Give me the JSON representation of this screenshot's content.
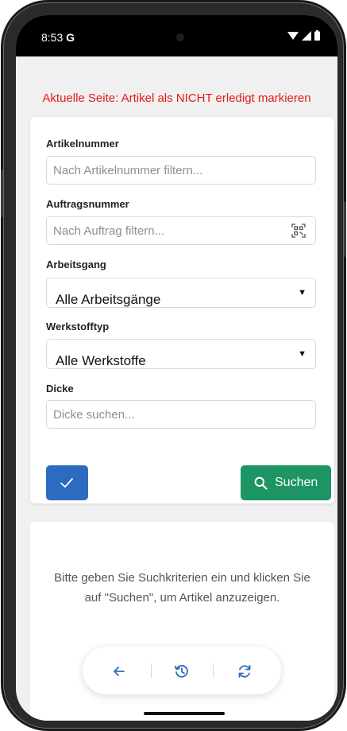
{
  "status_bar": {
    "time": "8:53",
    "carrier_glyph": "G"
  },
  "page_hint": "Aktuelle Seite: Artikel als NICHT erledigt markieren",
  "filters": {
    "article_label": "Artikelnummer",
    "article_placeholder": "Nach Artikelnummer filtern...",
    "order_label": "Auftragsnummer",
    "order_placeholder": "Nach Auftrag filtern...",
    "operation_label": "Arbeitsgang",
    "operation_value": "Alle Arbeitsgänge",
    "material_label": "Werkstofftyp",
    "material_value": "Alle Werkstoffe",
    "thickness_label": "Dicke",
    "thickness_placeholder": "Dicke suchen..."
  },
  "actions": {
    "search_label": "Suchen"
  },
  "result": {
    "message": "Bitte geben Sie Suchkriterien ein und klicken Sie auf \"Suchen\", um Artikel anzuzeigen."
  },
  "colors": {
    "hint": "#e31b1b",
    "primary": "#2c6bc0",
    "success": "#1d9463",
    "nav_icon": "#2c6bc0"
  },
  "icons": [
    "qr-code-icon",
    "check-icon",
    "search-icon",
    "arrow-left-icon",
    "history-icon",
    "refresh-icon",
    "wifi-icon",
    "signal-icon",
    "battery-icon"
  ]
}
